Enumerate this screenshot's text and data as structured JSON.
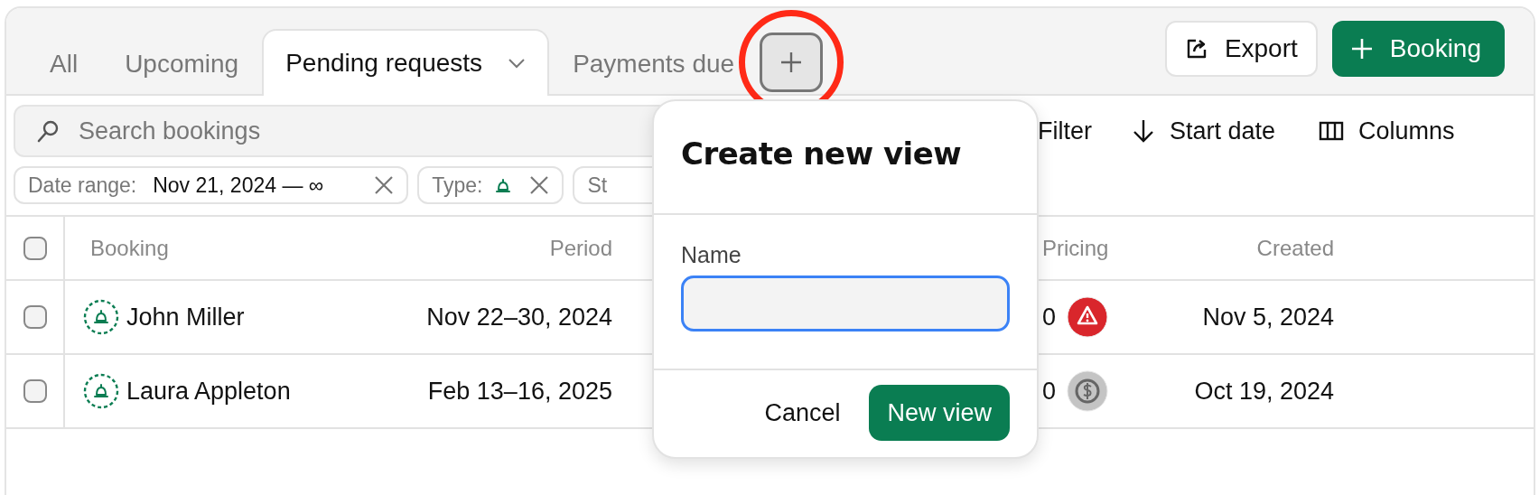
{
  "tabs": [
    {
      "label": "All",
      "selected": false,
      "dropdown": false
    },
    {
      "label": "Upcoming",
      "selected": false,
      "dropdown": false
    },
    {
      "label": "Pending requests",
      "selected": true,
      "dropdown": true
    },
    {
      "label": "Payments due",
      "selected": false,
      "dropdown": false
    }
  ],
  "actions": [
    {
      "kind": "export",
      "label": "Export"
    },
    {
      "kind": "primary",
      "label": "Booking"
    }
  ],
  "search": {
    "placeholder": "Search bookings"
  },
  "toolbar": [
    {
      "kind": "filter",
      "label": "Filter"
    },
    {
      "kind": "sort",
      "label": "Start date"
    },
    {
      "kind": "columns",
      "label": "Columns"
    }
  ],
  "filters": [
    {
      "label": "Date range:",
      "value": "Nov 21, 2024 — ∞",
      "kind": "text"
    },
    {
      "label": "Type:",
      "kind": "bell"
    },
    {
      "label": "St",
      "kind": "cut"
    }
  ],
  "table": {
    "header_checked": false,
    "columns": [
      "Booking",
      "Period",
      "Pricing",
      "Created"
    ],
    "rows": [
      {
        "checked": false,
        "booking": "John Miller",
        "period": "Nov 22–30, 2024",
        "pricing": {
          "text": "0",
          "kind": "alert"
        },
        "created": "Nov 5, 2024"
      },
      {
        "checked": false,
        "booking": "Laura Appleton",
        "period": "Feb 13–16, 2025",
        "pricing": {
          "text": "0",
          "kind": "paid"
        },
        "created": "Oct 19, 2024"
      }
    ]
  },
  "popover": {
    "title": "Create new view",
    "field_label": "Name",
    "buttons": [
      {
        "kind": "plain",
        "label": "Cancel"
      },
      {
        "kind": "primary",
        "label": "New view"
      }
    ]
  }
}
